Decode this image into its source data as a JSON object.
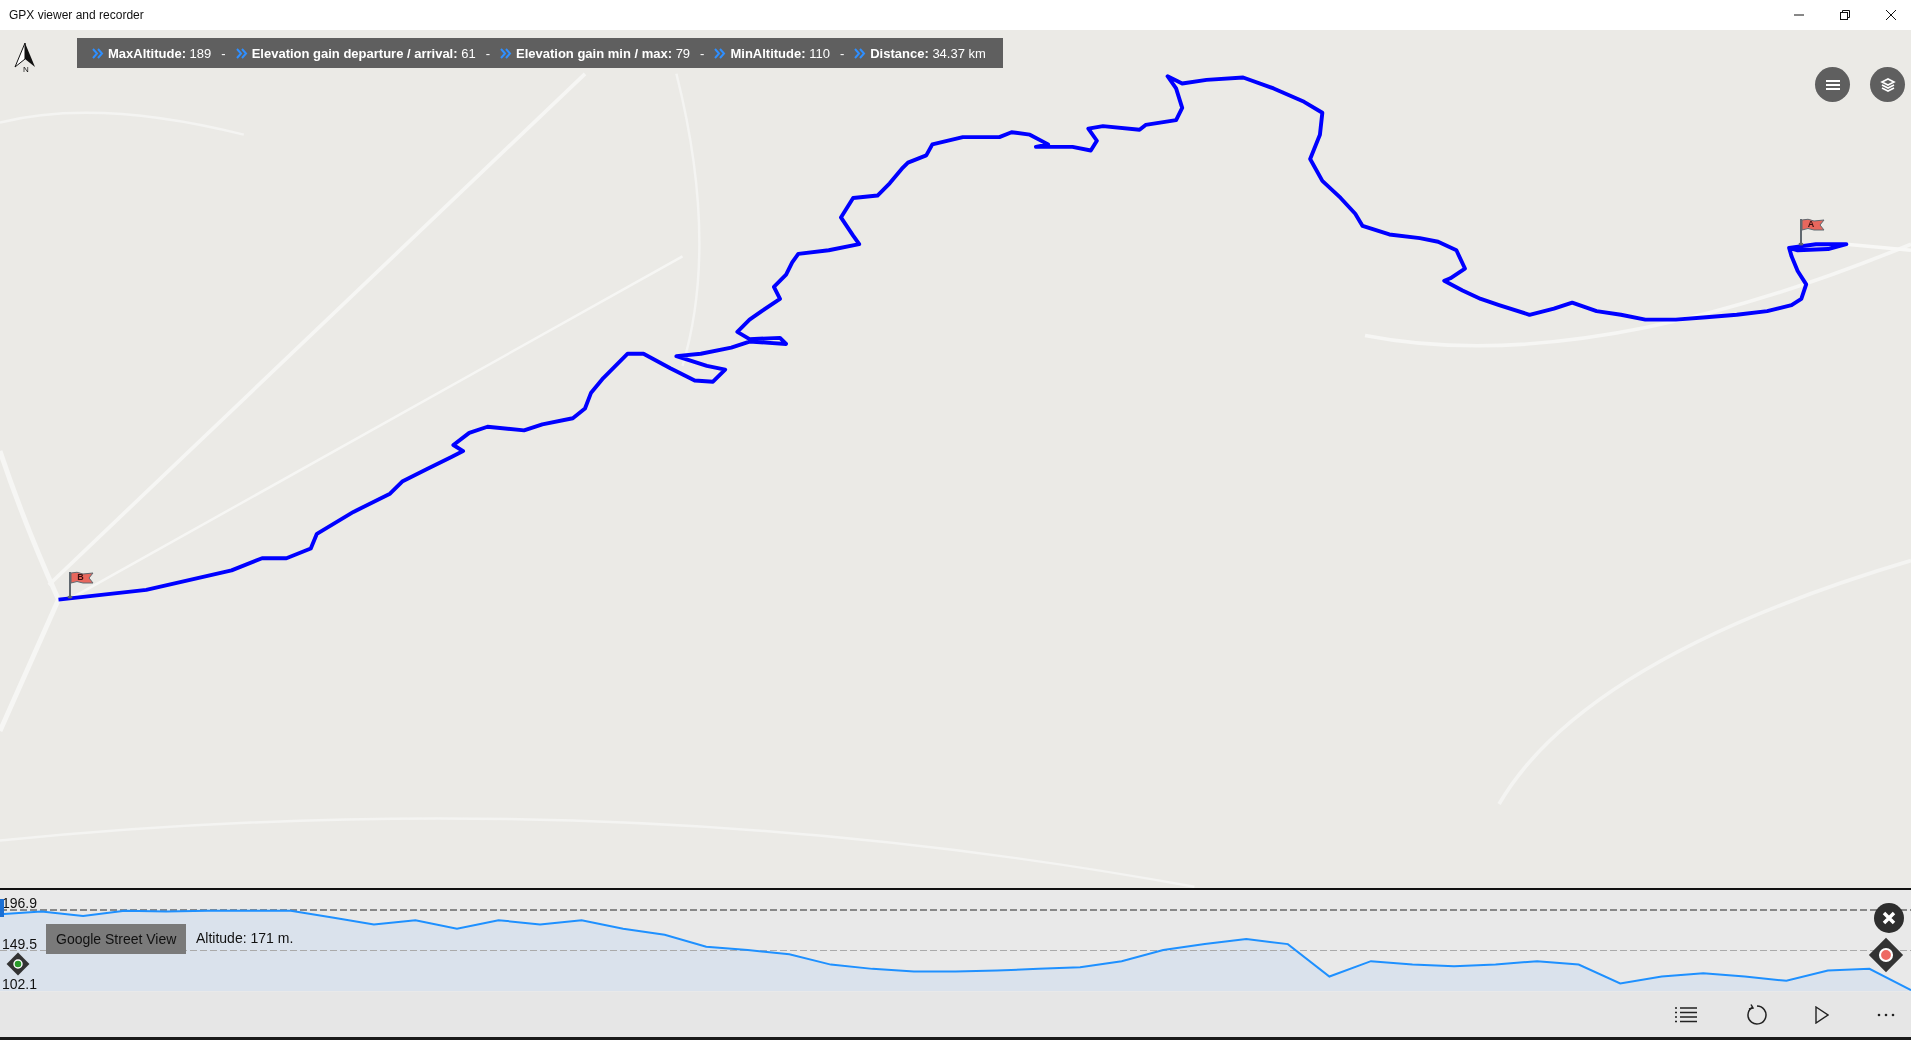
{
  "window": {
    "title": "GPX viewer and recorder"
  },
  "compass": {
    "label": "N"
  },
  "stats": [
    {
      "label": "MaxAltitude:",
      "value": "189",
      "separator": "-"
    },
    {
      "label": "Elevation gain departure / arrival:",
      "value": "61",
      "separator": "-"
    },
    {
      "label": "Elevation gain min / max:",
      "value": "79",
      "separator": "-"
    },
    {
      "label": "MinAltitude:",
      "value": "110",
      "separator": "-"
    },
    {
      "label": "Distance:",
      "value": "34.37 km"
    }
  ],
  "markers": [
    {
      "label": "B"
    },
    {
      "label": "A"
    }
  ],
  "profile": {
    "street_view_button": "Google Street View",
    "altitude": "Altitude: 171 m.",
    "chart_data": {
      "type": "area",
      "ylim": [
        102.1,
        196.9
      ],
      "yticks": [
        102.1,
        149.5,
        196.9
      ],
      "series": [
        {
          "color": "#1e90ff",
          "values": [
            192,
            195,
            190,
            196,
            195,
            196,
            196,
            196,
            188,
            180,
            185,
            175,
            185,
            180,
            185,
            175,
            168,
            154,
            150,
            145,
            133,
            128,
            125,
            125,
            126,
            128,
            130,
            137,
            150,
            157,
            163,
            157,
            119,
            137,
            133,
            131,
            133,
            137,
            133,
            111,
            119,
            123,
            119,
            114,
            126,
            128,
            103
          ]
        }
      ]
    }
  }
}
